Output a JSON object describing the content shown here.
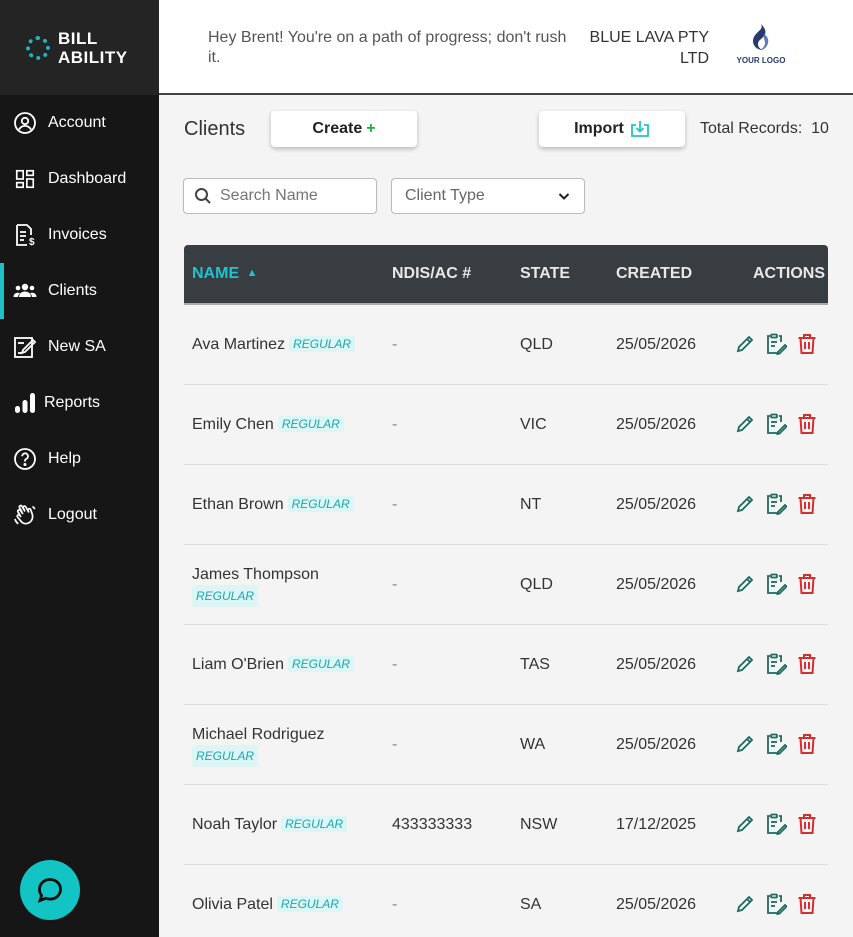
{
  "app": {
    "logo_line1": "BILL",
    "logo_line2": "ABILITY"
  },
  "sidebar": {
    "items": [
      {
        "label": "Account",
        "icon": "account-icon"
      },
      {
        "label": "Dashboard",
        "icon": "dashboard-icon"
      },
      {
        "label": "Invoices",
        "icon": "invoice-icon"
      },
      {
        "label": "Clients",
        "icon": "users-icon",
        "active": true
      },
      {
        "label": "New SA",
        "icon": "edit-document-icon"
      },
      {
        "label": "Reports",
        "icon": "bar-chart-icon"
      },
      {
        "label": "Help",
        "icon": "help-icon"
      },
      {
        "label": "Logout",
        "icon": "wave-hand-icon"
      }
    ]
  },
  "header": {
    "greeting": "Hey Brent! You're on a path of progress; don't rush it.",
    "company": "BLUE LAVA PTY LTD",
    "logo_text": "YOUR LOGO"
  },
  "main": {
    "title": "Clients",
    "create_label": "Create",
    "create_plus": "+",
    "import_label": "Import",
    "total_label": "Total Records:",
    "total_value": "10",
    "search_placeholder": "Search Name",
    "client_type_label": "Client Type"
  },
  "table": {
    "headers": {
      "name": "NAME",
      "ndis": "NDIS/AC #",
      "state": "STATE",
      "created": "CREATED",
      "actions": "ACTIONS"
    },
    "sort_indicator": "▲",
    "rows": [
      {
        "name": "Ava Martinez",
        "tag": "REGULAR",
        "ndis": "-",
        "state": "QLD",
        "created": "25/05/2026",
        "wrap": false
      },
      {
        "name": "Emily Chen",
        "tag": "REGULAR",
        "ndis": "-",
        "state": "VIC",
        "created": "25/05/2026",
        "wrap": false
      },
      {
        "name": "Ethan Brown",
        "tag": "REGULAR",
        "ndis": "-",
        "state": "NT",
        "created": "25/05/2026",
        "wrap": false
      },
      {
        "name": "James Thompson",
        "tag": "REGULAR",
        "ndis": "-",
        "state": "QLD",
        "created": "25/05/2026",
        "wrap": true
      },
      {
        "name": "Liam O'Brien",
        "tag": "REGULAR",
        "ndis": "-",
        "state": "TAS",
        "created": "25/05/2026",
        "wrap": false
      },
      {
        "name": "Michael Rodriguez",
        "tag": "REGULAR",
        "ndis": "-",
        "state": "WA",
        "created": "25/05/2026",
        "wrap": true
      },
      {
        "name": "Noah Taylor",
        "tag": "REGULAR",
        "ndis": "433333333",
        "state": "NSW",
        "created": "17/12/2025",
        "wrap": false
      },
      {
        "name": "Olivia Patel",
        "tag": "REGULAR",
        "ndis": "-",
        "state": "SA",
        "created": "25/05/2026",
        "wrap": false
      }
    ]
  },
  "colors": {
    "accent": "#1ec4cf",
    "sidebar_bg": "#161616",
    "delete": "#d32f2f",
    "edit": "#1e6b5c"
  }
}
